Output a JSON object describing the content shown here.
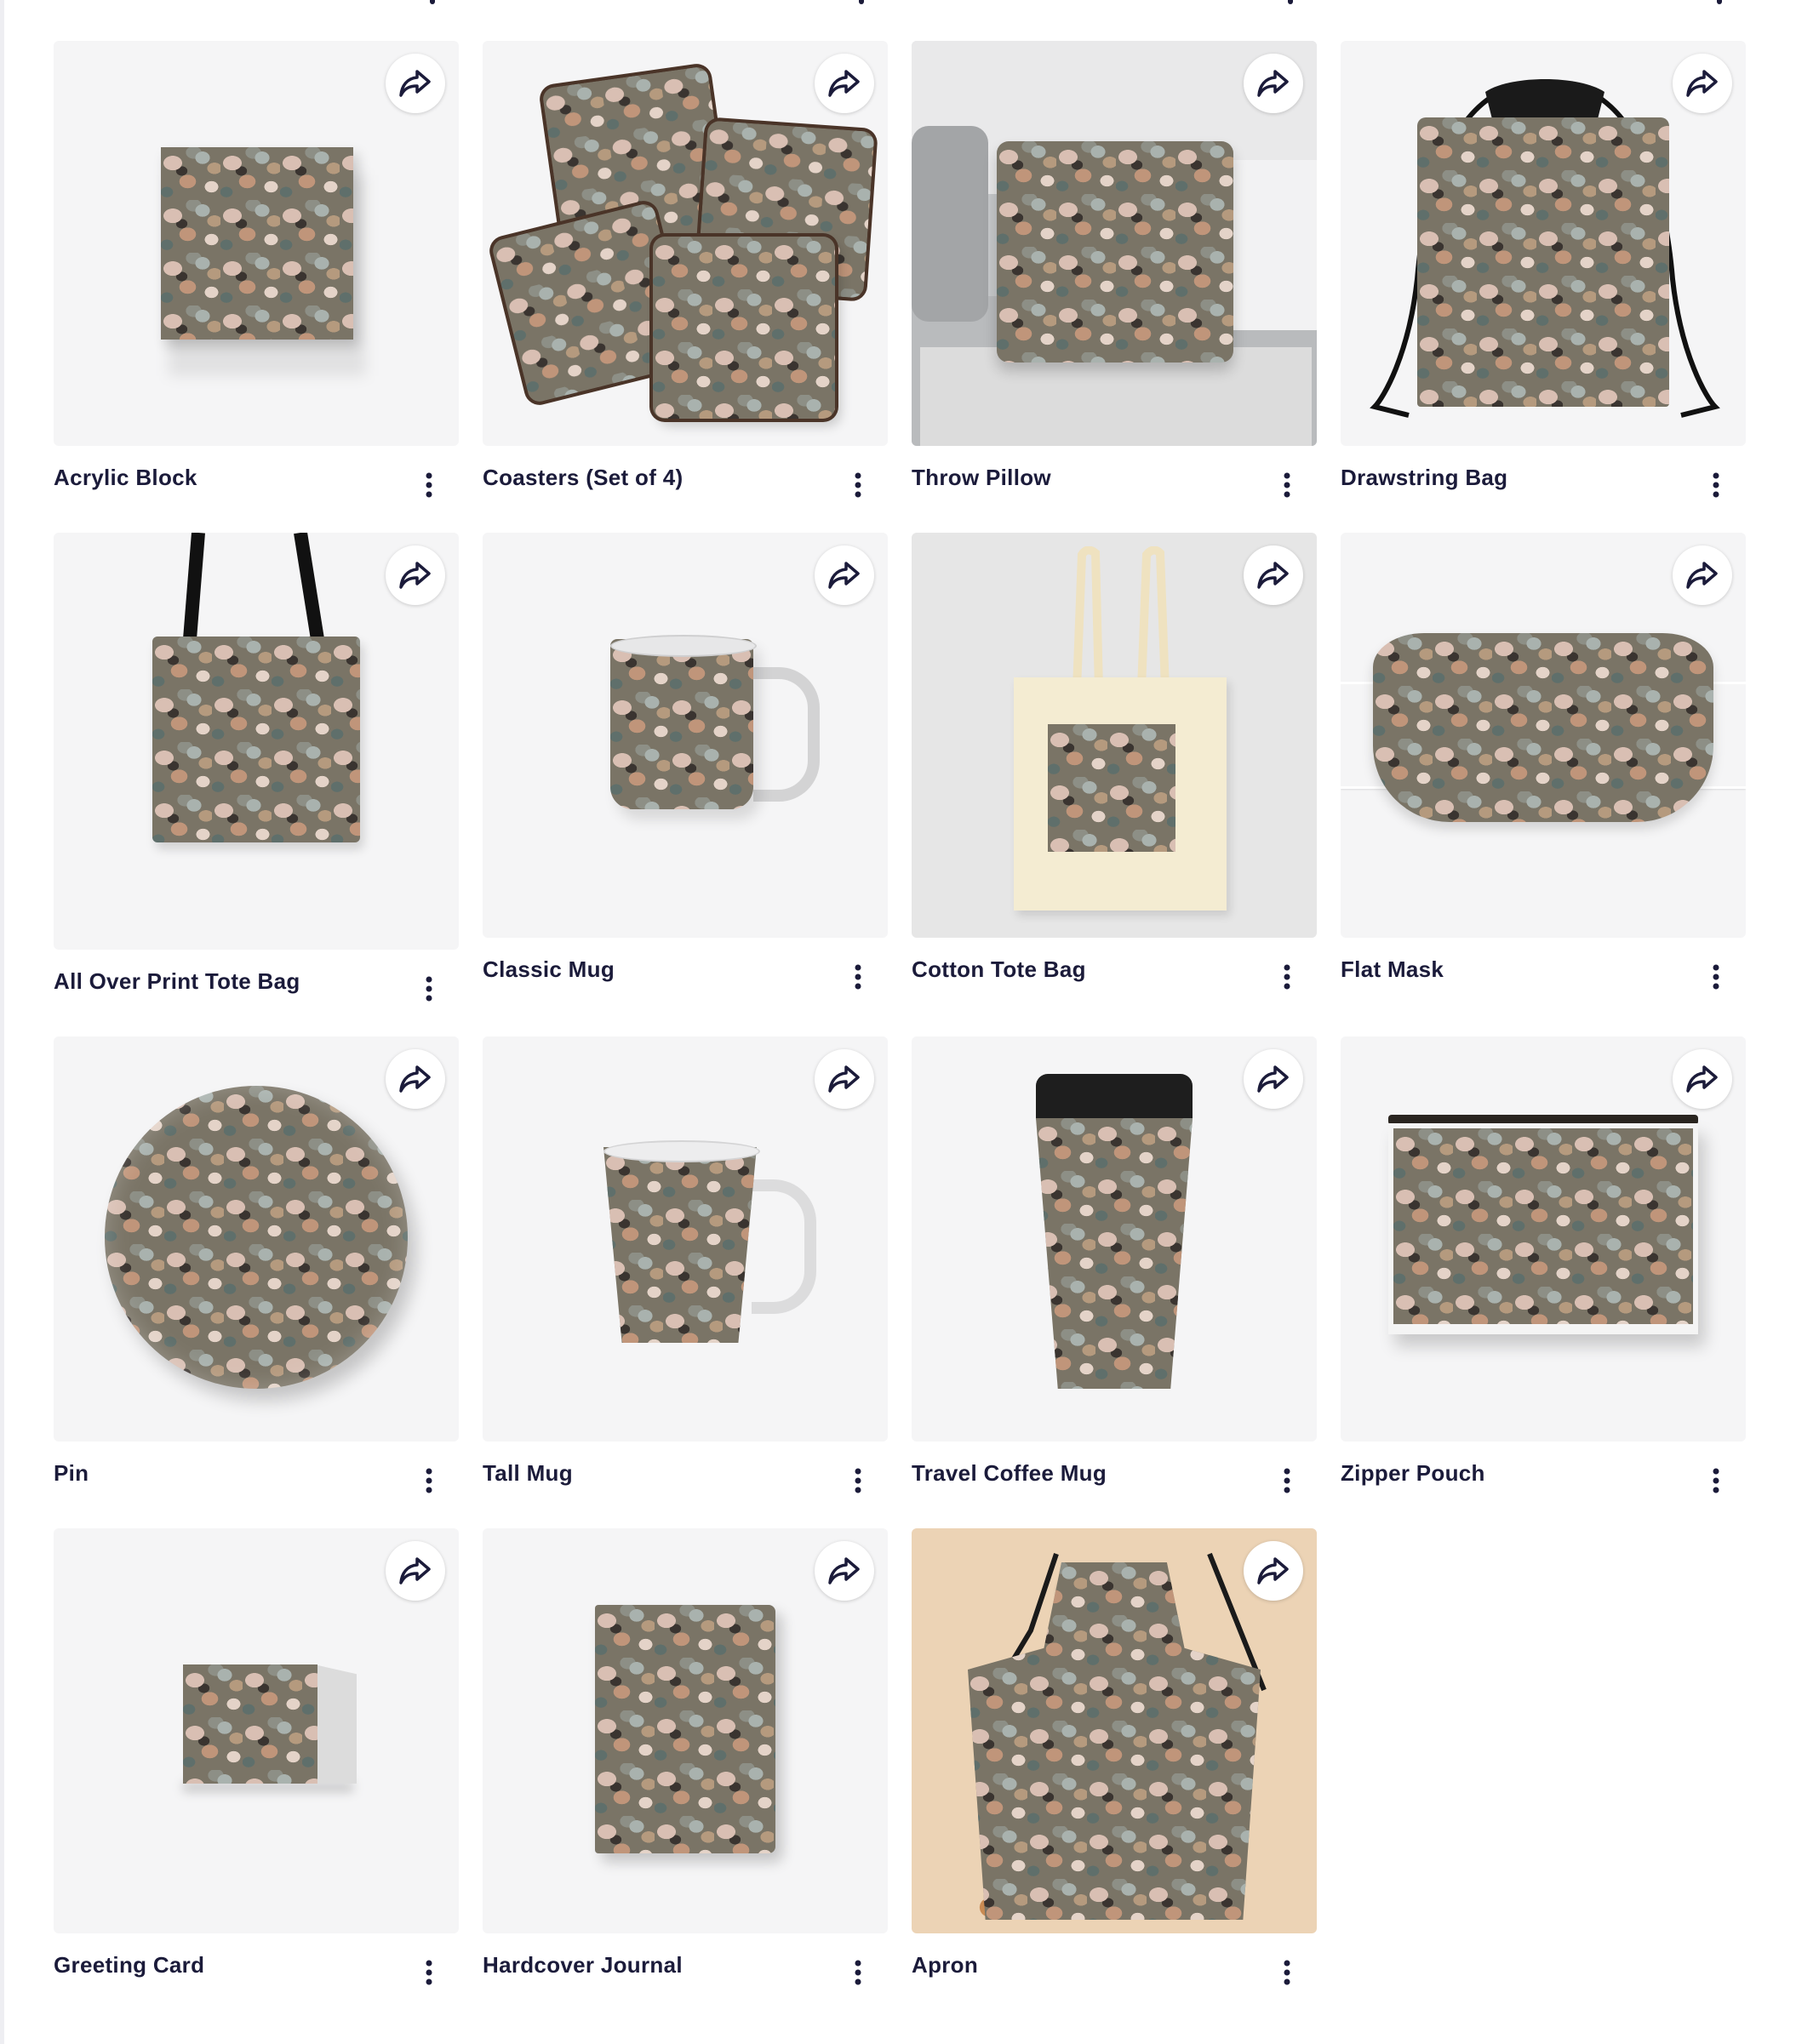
{
  "products": [
    {
      "title": "Acrylic Block",
      "icon": "acrylic-block-image"
    },
    {
      "title": "Coasters (Set of 4)",
      "icon": "coasters-image"
    },
    {
      "title": "Throw Pillow",
      "icon": "throw-pillow-image"
    },
    {
      "title": "Drawstring Bag",
      "icon": "drawstring-bag-image"
    },
    {
      "title": "All Over Print Tote Bag",
      "icon": "all-over-print-tote-bag-image"
    },
    {
      "title": "Classic Mug",
      "icon": "classic-mug-image"
    },
    {
      "title": "Cotton Tote Bag",
      "icon": "cotton-tote-bag-image"
    },
    {
      "title": "Flat Mask",
      "icon": "flat-mask-image"
    },
    {
      "title": "Pin",
      "icon": "pin-image"
    },
    {
      "title": "Tall Mug",
      "icon": "tall-mug-image"
    },
    {
      "title": "Travel Coffee Mug",
      "icon": "travel-coffee-mug-image"
    },
    {
      "title": "Zipper Pouch",
      "icon": "zipper-pouch-image"
    },
    {
      "title": "Greeting Card",
      "icon": "greeting-card-image"
    },
    {
      "title": "Hardcover Journal",
      "icon": "hardcover-journal-image"
    },
    {
      "title": "Apron",
      "icon": "apron-image"
    }
  ],
  "icons": {
    "share": "share-icon",
    "more": "more-vertical-icon"
  },
  "colors": {
    "text": "#1b1b3a",
    "tile_background": "#f5f5f6",
    "share_button": "#ffffff"
  }
}
